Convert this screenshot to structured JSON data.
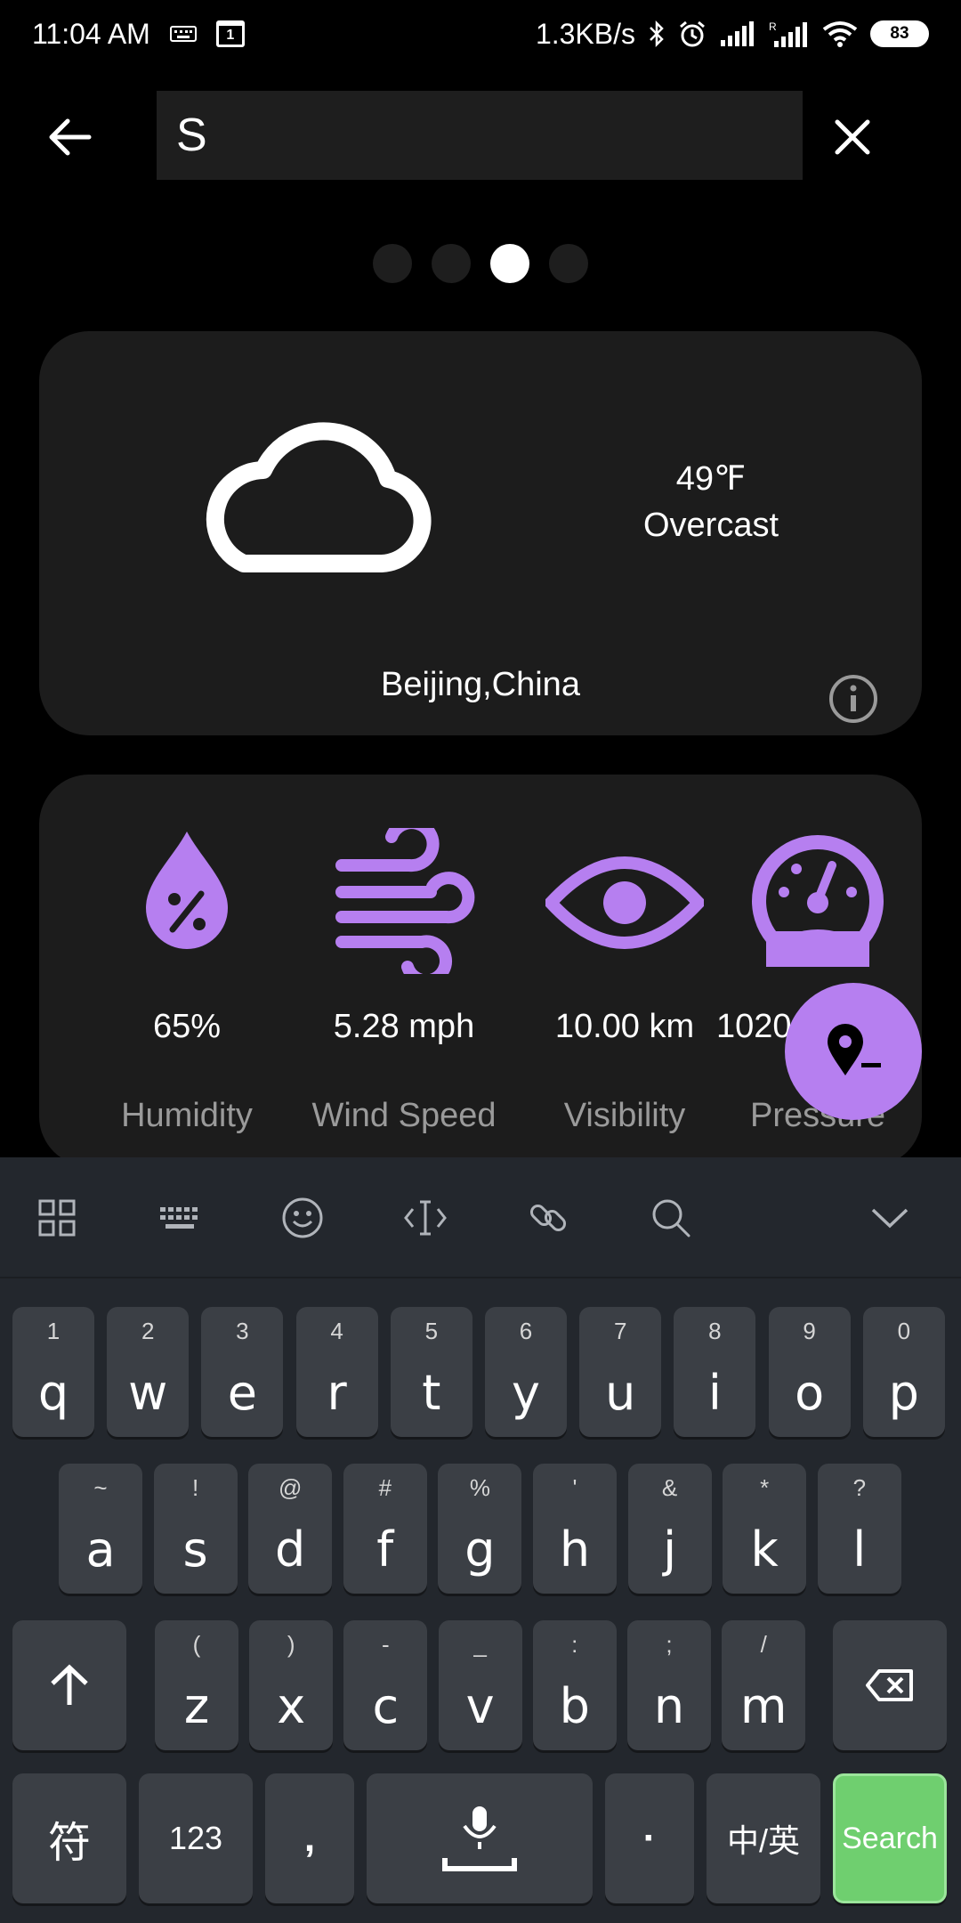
{
  "status_bar": {
    "time": "11:04 AM",
    "net_speed": "1.3KB/s",
    "battery": "83",
    "calendar_day": "1"
  },
  "search": {
    "value": "S"
  },
  "pager": {
    "count": 4,
    "active_index": 2
  },
  "weather": {
    "temperature": "49℉",
    "condition": "Overcast",
    "location": "Beijing,China"
  },
  "stats": {
    "humidity": {
      "value": "65%",
      "label": "Humidity"
    },
    "wind": {
      "value": "5.28 mph",
      "label": "Wind Speed"
    },
    "visibility": {
      "value": "10.00 km",
      "label": "Visibility"
    },
    "pressure": {
      "value": "1020",
      "label": "Pressure"
    }
  },
  "keyboard": {
    "row1": [
      {
        "main": "q",
        "hint": "1"
      },
      {
        "main": "w",
        "hint": "2"
      },
      {
        "main": "e",
        "hint": "3"
      },
      {
        "main": "r",
        "hint": "4"
      },
      {
        "main": "t",
        "hint": "5"
      },
      {
        "main": "y",
        "hint": "6"
      },
      {
        "main": "u",
        "hint": "7"
      },
      {
        "main": "i",
        "hint": "8"
      },
      {
        "main": "o",
        "hint": "9"
      },
      {
        "main": "p",
        "hint": "0"
      }
    ],
    "row2": [
      {
        "main": "a",
        "hint": "~"
      },
      {
        "main": "s",
        "hint": "!"
      },
      {
        "main": "d",
        "hint": "@"
      },
      {
        "main": "f",
        "hint": "#"
      },
      {
        "main": "g",
        "hint": "%"
      },
      {
        "main": "h",
        "hint": "'"
      },
      {
        "main": "j",
        "hint": "&"
      },
      {
        "main": "k",
        "hint": "*"
      },
      {
        "main": "l",
        "hint": "?"
      }
    ],
    "row3": [
      {
        "main": "z",
        "hint": "("
      },
      {
        "main": "x",
        "hint": ")"
      },
      {
        "main": "c",
        "hint": "-"
      },
      {
        "main": "v",
        "hint": "_"
      },
      {
        "main": "b",
        "hint": ":"
      },
      {
        "main": "n",
        "hint": ";"
      },
      {
        "main": "m",
        "hint": "/"
      }
    ],
    "symbols_label": "符",
    "numbers_label": "123",
    "comma_label": ",",
    "period_label": "·",
    "lang_label": "中/英",
    "search_label": "Search"
  },
  "colors": {
    "accent": "#B67FF0",
    "card": "#1C1C1C",
    "keyboard_bg": "#23272D",
    "key_bg": "#3B3F45",
    "search_key": "#6FCF6F"
  }
}
